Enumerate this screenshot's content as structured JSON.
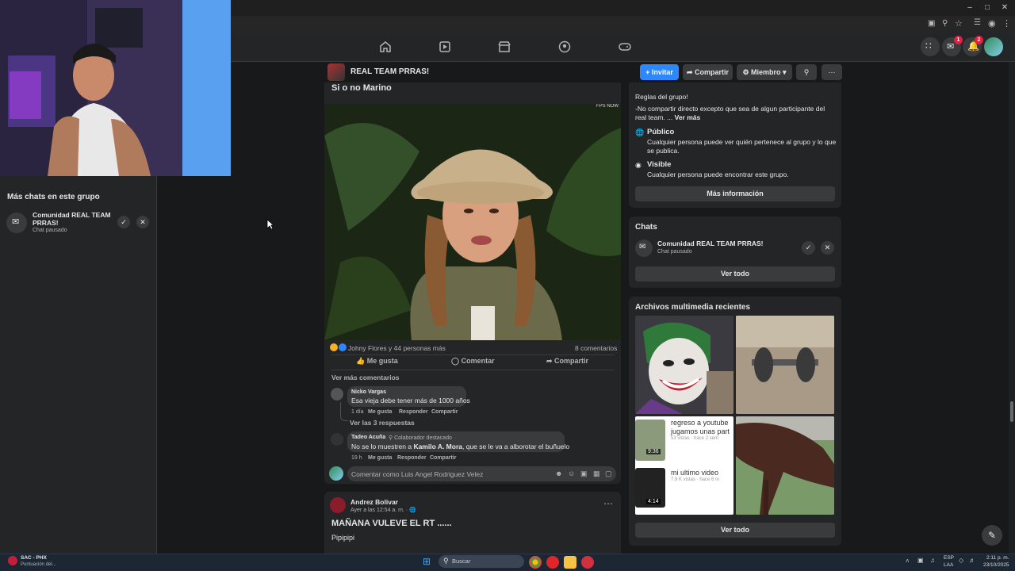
{
  "webcam": {
    "alt": "streamer webcam"
  },
  "left_panel": {
    "title": "Más chats en este grupo",
    "chat": {
      "name": "Comunidad REAL TEAM PRRAS!",
      "status": "Chat pausado"
    }
  },
  "group_header": {
    "name": "REAL TEAM PRRAS!",
    "invite_label": "Invitar",
    "share_label": "Compartir",
    "member_label": "Miembro"
  },
  "post": {
    "title": "Si o no Marino",
    "reactions_text": "Johny Flores y 44 personas más",
    "comments_count": "8 comentarios",
    "like_label": "Me gusta",
    "comment_label": "Comentar",
    "share_label": "Compartir",
    "more_comments": "Ver más comentarios",
    "video_corner": "FPS NOW",
    "comments": [
      {
        "author": "Nicko Vargas",
        "badge": "",
        "text": "Esa vieja debe tener más de 1000 años",
        "time": "1 día",
        "like": "Me gusta",
        "reply": "Responder",
        "share": "Compartir"
      },
      {
        "author": "Tadeo Acuña",
        "badge": "Colaborador destacado",
        "text_pre": "No se lo muestren a ",
        "text_mention": "Kamilo A. Mora",
        "text_post": ", que se le va a alborotar el buñuelo",
        "time": "19 h",
        "like": "Me gusta",
        "reply": "Responder",
        "share": "Compartir"
      }
    ],
    "replies_link": "Ver las 3 respuestas",
    "comment_placeholder": "Comentar como Luis Angel Rodriguez Velez"
  },
  "post2": {
    "author": "Andrez Bolivar",
    "time": "Ayer a las 12:54 a. m. ·",
    "title": "MAÑANA VULEVE EL RT ......",
    "body": "Pipipipi"
  },
  "about": {
    "rules_title": "Reglas del grupo!",
    "rules_text": "-No compartir directo excepto que sea de algun participante del real team. ...",
    "rules_more": "Ver más",
    "public_title": "Público",
    "public_text": "Cualquier persona puede ver quién pertenece al grupo y lo que se publica.",
    "visible_title": "Visible",
    "visible_text": "Cualquier persona puede encontrar este grupo.",
    "more_info": "Más información"
  },
  "chats": {
    "title": "Chats",
    "name": "Comunidad REAL TEAM PRRAS!",
    "status": "Chat pausado",
    "see_all": "Ver todo"
  },
  "media": {
    "title": "Archivos multimedia recientes",
    "video1_line1": "regreso a youtube",
    "video1_line2": "jugamos unas part",
    "video1_views": "53 vistas · hace 2 sem",
    "video1_duration": "9:36",
    "video2_line1": "mi ultimo video",
    "video2_views": "7.9 K vistas · hace 6 m",
    "video2_duration": "4:14",
    "see_all": "Ver todo"
  },
  "notifications": {
    "messenger_badge": "1",
    "bell_badge": "2"
  },
  "taskbar": {
    "app_title": "SAC - PHX",
    "app_sub": "Puntuación del...",
    "search": "Buscar",
    "lang1": "ESP",
    "lang2": "LAA",
    "time": "2:11 p. m.",
    "date": "23/10/2025"
  }
}
